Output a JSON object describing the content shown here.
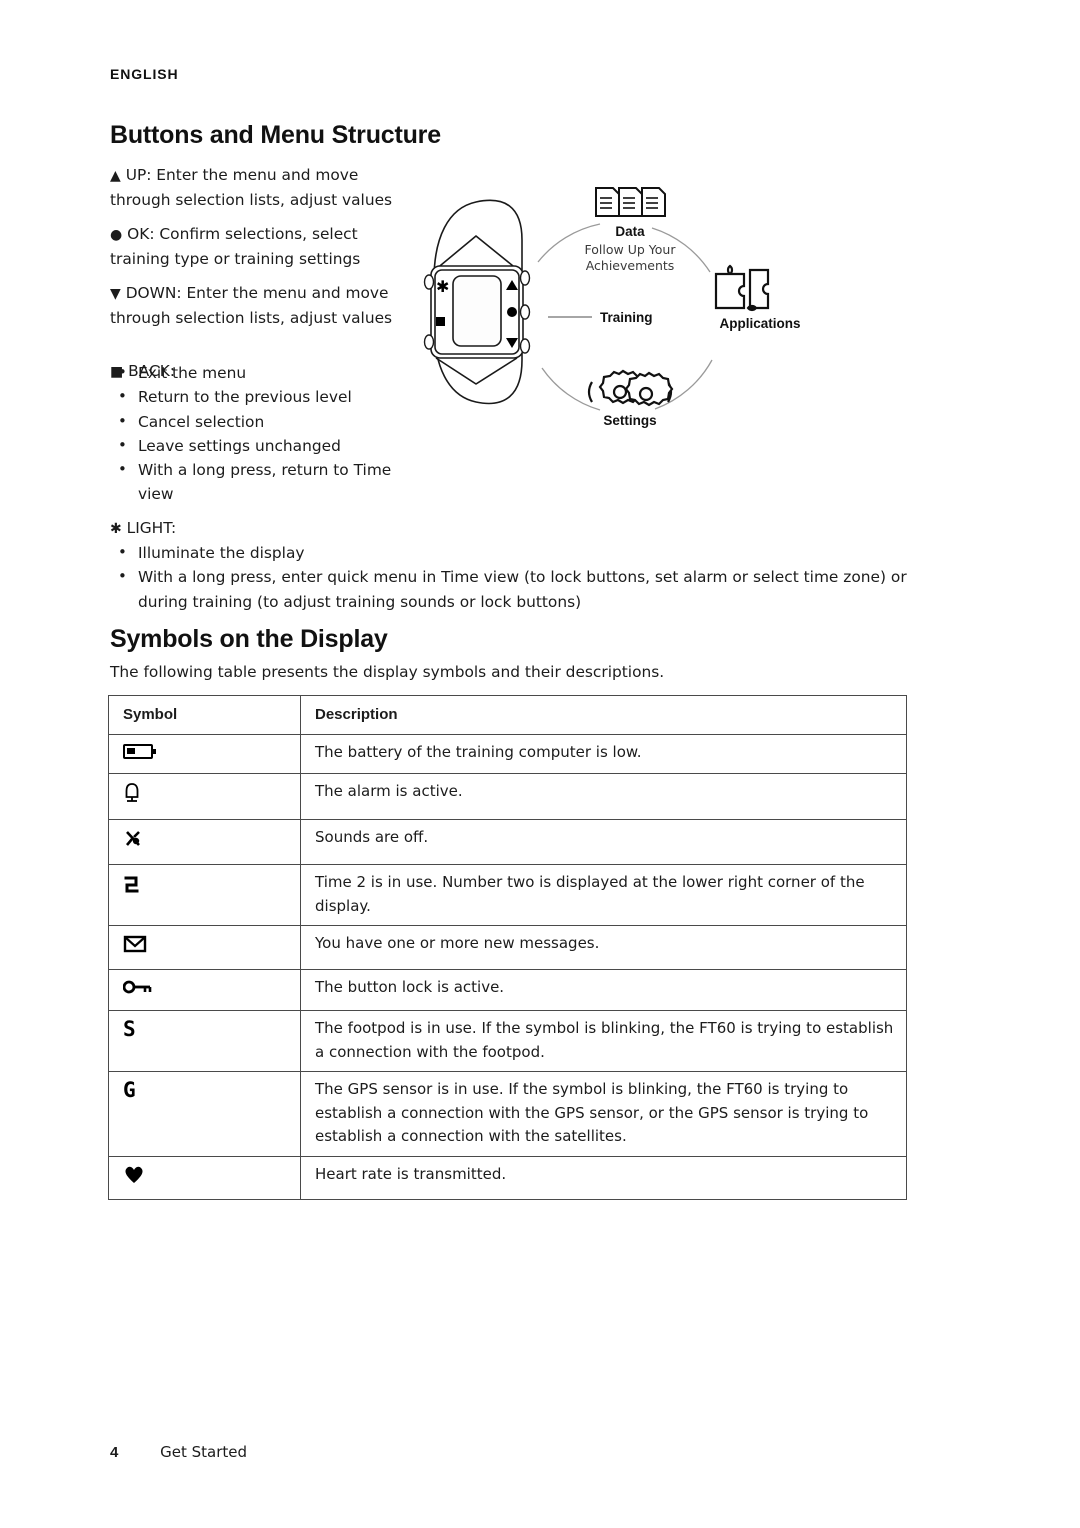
{
  "running_head": "ENGLISH",
  "headings": {
    "buttons": "Buttons and Menu Structure",
    "symbols": "Symbols on the Display"
  },
  "buttons_section": {
    "up": {
      "marker": "▲",
      "text": "UP: Enter the menu and move through selection lists, adjust values"
    },
    "ok": {
      "marker": "●",
      "text": "OK: Confirm selections, select training type or training settings"
    },
    "down": {
      "marker": "▼",
      "text": "DOWN: Enter the menu and move through selection lists, adjust values"
    },
    "back": {
      "marker": "■",
      "text": "BACK:",
      "items": [
        "Exit the menu",
        "Return to the previous level",
        "Cancel selection",
        "Leave settings unchanged",
        "With a long press, return to Time view"
      ]
    },
    "light": {
      "marker": "✱",
      "text": "LIGHT:",
      "items": [
        "Illuminate the display",
        "With a long press, enter quick menu in Time view (to lock buttons, set alarm or select time zone) or during training (to adjust training sounds or lock buttons)"
      ]
    }
  },
  "diagram": {
    "data_label": "Data",
    "data_sub_line1": "Follow Up Your",
    "data_sub_line2": "Achievements",
    "applications_label": "Applications",
    "training_label": "Training",
    "settings_label": "Settings",
    "watch_buttons": {
      "light": "✱",
      "back": "■",
      "up": "▲",
      "ok": "●",
      "down": "▼"
    }
  },
  "symbols_section": {
    "intro": "The following table presents the display symbols and their descriptions.",
    "table": {
      "headers": [
        "Symbol",
        "Description"
      ],
      "rows": [
        {
          "symbol_name": "battery-low-icon",
          "symbol_glyph": "",
          "description": "The battery of the training computer is low."
        },
        {
          "symbol_name": "alarm-bell-icon",
          "symbol_glyph": "⌂",
          "description": "The alarm is active."
        },
        {
          "symbol_name": "sounds-off-icon",
          "symbol_glyph": "✗",
          "description": "Sounds are off."
        },
        {
          "symbol_name": "time-two-icon",
          "symbol_glyph": "2",
          "description": "Time 2 is in use. Number two is displayed at the lower right corner of the display."
        },
        {
          "symbol_name": "new-message-icon",
          "symbol_glyph": "✉",
          "description": "You have one or more new messages."
        },
        {
          "symbol_name": "button-lock-key-icon",
          "symbol_glyph": "⚷",
          "description": "The button lock is active."
        },
        {
          "symbol_name": "footpod-s-icon",
          "symbol_glyph": "S",
          "description": "The footpod is in use. If the symbol is blinking, the FT60 is trying to establish a connection with the footpod."
        },
        {
          "symbol_name": "gps-g-icon",
          "symbol_glyph": "G",
          "description": "The GPS sensor is in use. If the symbol is blinking, the FT60 is trying to establish a connection with the GPS sensor, or the GPS sensor is trying to establish a connection with the satellites."
        },
        {
          "symbol_name": "heart-rate-icon",
          "symbol_glyph": "♥",
          "description": "Heart rate is transmitted."
        }
      ]
    }
  },
  "footer": {
    "page_number": "4",
    "chapter": "Get Started"
  }
}
